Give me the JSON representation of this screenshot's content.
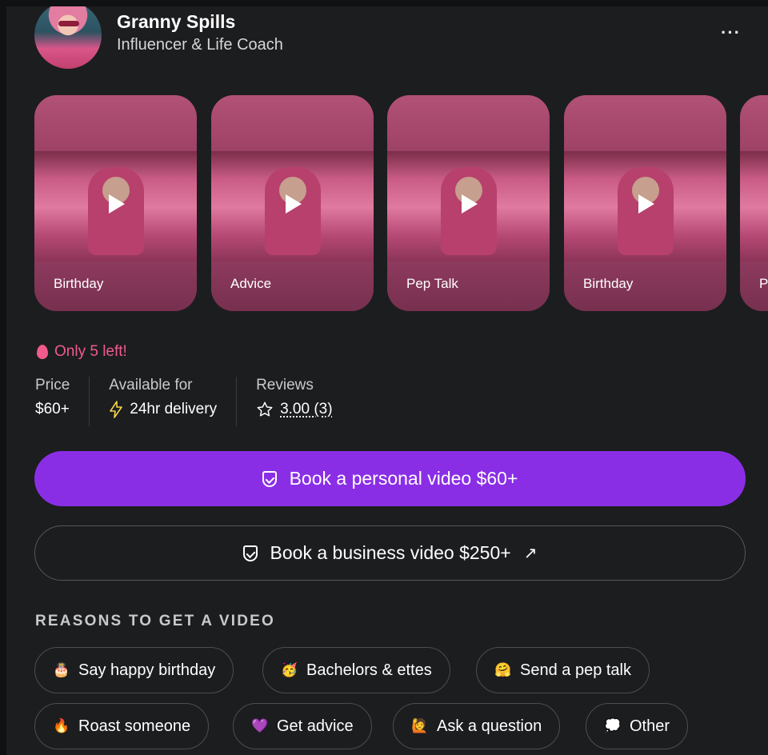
{
  "profile": {
    "name": "Granny Spills",
    "subtitle": "Influencer & Life Coach",
    "more": "···"
  },
  "videos": [
    {
      "label": "Birthday"
    },
    {
      "label": "Advice"
    },
    {
      "label": "Pep Talk"
    },
    {
      "label": "Birthday"
    },
    {
      "label": "P"
    }
  ],
  "urgency": "Only 5 left!",
  "stats": {
    "price": {
      "label": "Price",
      "value": "$60+"
    },
    "availability": {
      "label": "Available for",
      "value": "24hr delivery"
    },
    "reviews": {
      "label": "Reviews",
      "value": "3.00 (3)"
    }
  },
  "buttons": {
    "personal": "Book a personal video $60+",
    "business": "Book a business video $250+",
    "external_arrow": "↗"
  },
  "reasons": {
    "title": "REASONS TO GET A VIDEO",
    "chips": [
      {
        "label": "Say happy birthday",
        "emoji": "🎂",
        "icon": "cake-icon",
        "color": "#f3e9dc"
      },
      {
        "label": "Bachelors & ettes",
        "emoji": "🥳",
        "icon": "party-face-icon",
        "color": "#f2b94b"
      },
      {
        "label": "Send a pep talk",
        "emoji": "🤗",
        "icon": "hug-face-icon",
        "color": "#f2b94b"
      },
      {
        "label": "Roast someone",
        "emoji": "🔥",
        "icon": "fire-icon",
        "color": "#f07a2a"
      },
      {
        "label": "Get advice",
        "emoji": "💜",
        "icon": "purple-heart-icon",
        "color": "#9a4fe0"
      },
      {
        "label": "Ask a question",
        "emoji": "🙋",
        "icon": "raised-hand-icon",
        "color": "#e8a15a"
      },
      {
        "label": "Other",
        "emoji": "💭",
        "icon": "thought-bubble-icon",
        "color": "#f0f0f0"
      }
    ]
  },
  "colors": {
    "accent": "#8a2ee6",
    "urgency": "#f05b8c",
    "background": "#1c1d1f"
  }
}
